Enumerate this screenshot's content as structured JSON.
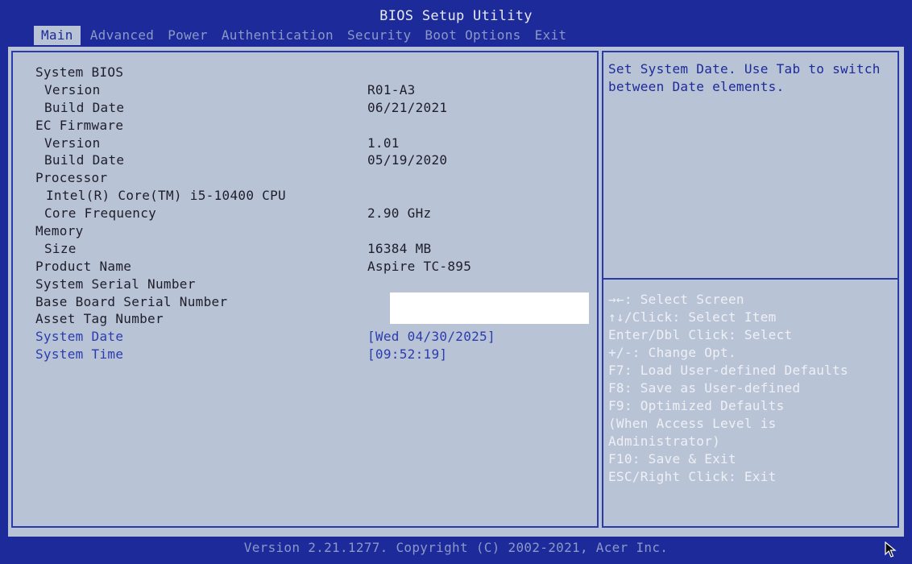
{
  "window": {
    "title": "BIOS Setup Utility"
  },
  "tabs": [
    {
      "label": "Main",
      "active": true
    },
    {
      "label": "Advanced"
    },
    {
      "label": "Power"
    },
    {
      "label": "Authentication"
    },
    {
      "label": "Security"
    },
    {
      "label": "Boot Options"
    },
    {
      "label": "Exit"
    }
  ],
  "main": {
    "rows": [
      {
        "label": "System BIOS",
        "value": ""
      },
      {
        "label": "Version",
        "value": "R01-A3"
      },
      {
        "label": "Build Date",
        "value": "06/21/2021"
      },
      {
        "label": "EC Firmware",
        "value": ""
      },
      {
        "label": "Version",
        "value": "1.01"
      },
      {
        "label": "Build Date",
        "value": "05/19/2020"
      },
      {
        "label": "Processor",
        "value": ""
      },
      {
        "label": "Intel(R) Core(TM) i5-10400 CPU",
        "value": ""
      },
      {
        "label": "Core Frequency",
        "value": "2.90 GHz"
      },
      {
        "label": "Memory",
        "value": ""
      },
      {
        "label": "Size",
        "value": "16384 MB"
      },
      {
        "label": "Product Name",
        "value": "Aspire TC-895"
      },
      {
        "label": "System Serial Number",
        "value": ""
      },
      {
        "label": "Base Board Serial Number",
        "value": ""
      },
      {
        "label": "Asset Tag Number",
        "value": ""
      },
      {
        "label": "System Date",
        "value": "[Wed 04/30/2025]"
      },
      {
        "label": "System Time",
        "value": "[09:52:19]"
      }
    ]
  },
  "help": {
    "description": "Set System Date. Use Tab to switch between Date elements.",
    "keys": [
      "→←: Select Screen",
      "↑↓/Click: Select Item",
      "Enter/Dbl Click: Select",
      "+/-: Change Opt.",
      "F7: Load User-defined Defaults",
      "F8: Save as User-defined",
      "F9: Optimized Defaults",
      "(When Access Level is",
      "Administrator)",
      "F10: Save & Exit",
      "ESC/Right Click: Exit"
    ]
  },
  "footer": {
    "text": "Version 2.21.1277. Copyright (C) 2002-2021, Acer Inc."
  },
  "colors": {
    "chrome_blue": "#1c2a9a",
    "panel_gray": "#b9c3d6",
    "selected_text": "#2b3cb0",
    "help_text": "#eef0f6"
  },
  "icons": {
    "cursor": "mouse-pointer-icon"
  }
}
